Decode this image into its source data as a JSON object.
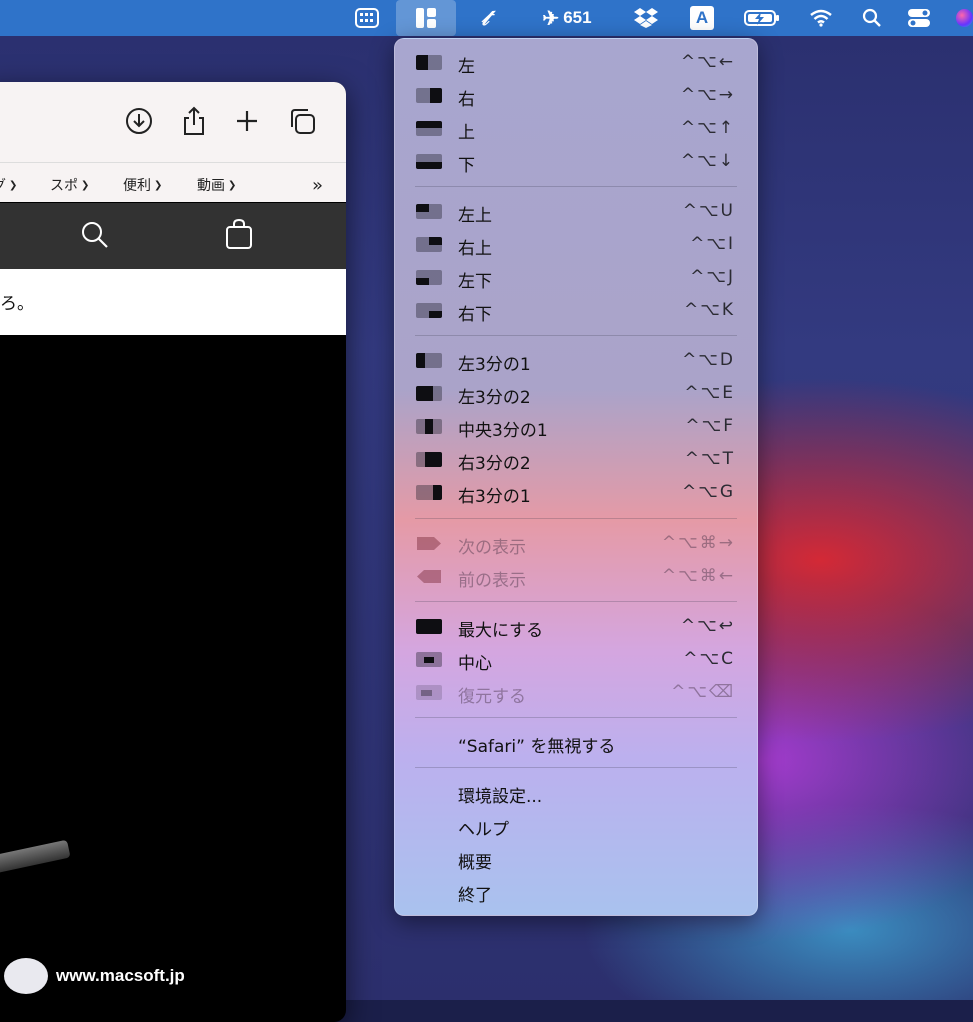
{
  "menubar": {
    "flight_count": "651",
    "keyboard_letter": "A"
  },
  "safari": {
    "favorites": [
      {
        "label": "グ"
      },
      {
        "label": "スポ"
      },
      {
        "label": "便利"
      },
      {
        "label": "動画"
      }
    ],
    "page_text": "ろ。"
  },
  "watermark": {
    "text": "www.macsoft.jp"
  },
  "menu": {
    "items": [
      {
        "label": "左",
        "shortcut": "^⌥←",
        "icon": "half-left",
        "disabled": false
      },
      {
        "label": "右",
        "shortcut": "^⌥→",
        "icon": "half-right",
        "disabled": false
      },
      {
        "label": "上",
        "shortcut": "^⌥↑",
        "icon": "half-top",
        "disabled": false
      },
      {
        "label": "下",
        "shortcut": "^⌥↓",
        "icon": "half-bottom",
        "disabled": false
      },
      {
        "label": "左上",
        "shortcut": "^⌥U",
        "icon": "quarter-top-left",
        "disabled": false
      },
      {
        "label": "右上",
        "shortcut": "^⌥I",
        "icon": "quarter-top-right",
        "disabled": false
      },
      {
        "label": "左下",
        "shortcut": "^⌥J",
        "icon": "quarter-bottom-left",
        "disabled": false
      },
      {
        "label": "右下",
        "shortcut": "^⌥K",
        "icon": "quarter-bottom-right",
        "disabled": false
      },
      {
        "label": "左3分の1",
        "shortcut": "^⌥D",
        "icon": "third-left",
        "disabled": false
      },
      {
        "label": "左3分の2",
        "shortcut": "^⌥E",
        "icon": "two-thirds-left",
        "disabled": false
      },
      {
        "label": "中央3分の1",
        "shortcut": "^⌥F",
        "icon": "third-center",
        "disabled": false
      },
      {
        "label": "右3分の2",
        "shortcut": "^⌥T",
        "icon": "two-thirds-right",
        "disabled": false
      },
      {
        "label": "右3分の1",
        "shortcut": "^⌥G",
        "icon": "third-right",
        "disabled": false
      },
      {
        "label": "次の表示",
        "shortcut": "^⌥⌘→",
        "icon": "next-display",
        "disabled": true
      },
      {
        "label": "前の表示",
        "shortcut": "^⌥⌘←",
        "icon": "previous-display",
        "disabled": true
      },
      {
        "label": "最大にする",
        "shortcut": "^⌥↩",
        "icon": "maximize",
        "disabled": false
      },
      {
        "label": "中心",
        "shortcut": "^⌥C",
        "icon": "center",
        "disabled": false
      },
      {
        "label": "復元する",
        "shortcut": "^⌥⌫",
        "icon": "restore",
        "disabled": true
      },
      {
        "label": "“Safari” を無視する",
        "shortcut": "",
        "icon": "",
        "disabled": false
      },
      {
        "label": "環境設定...",
        "shortcut": "",
        "icon": "",
        "disabled": false
      },
      {
        "label": "ヘルプ",
        "shortcut": "",
        "icon": "",
        "disabled": false
      },
      {
        "label": "概要",
        "shortcut": "",
        "icon": "",
        "disabled": false
      },
      {
        "label": "終了",
        "shortcut": "",
        "icon": "",
        "disabled": false
      }
    ]
  },
  "colors": {
    "menubar": "#2f73c9",
    "menu_text": "#111111"
  }
}
